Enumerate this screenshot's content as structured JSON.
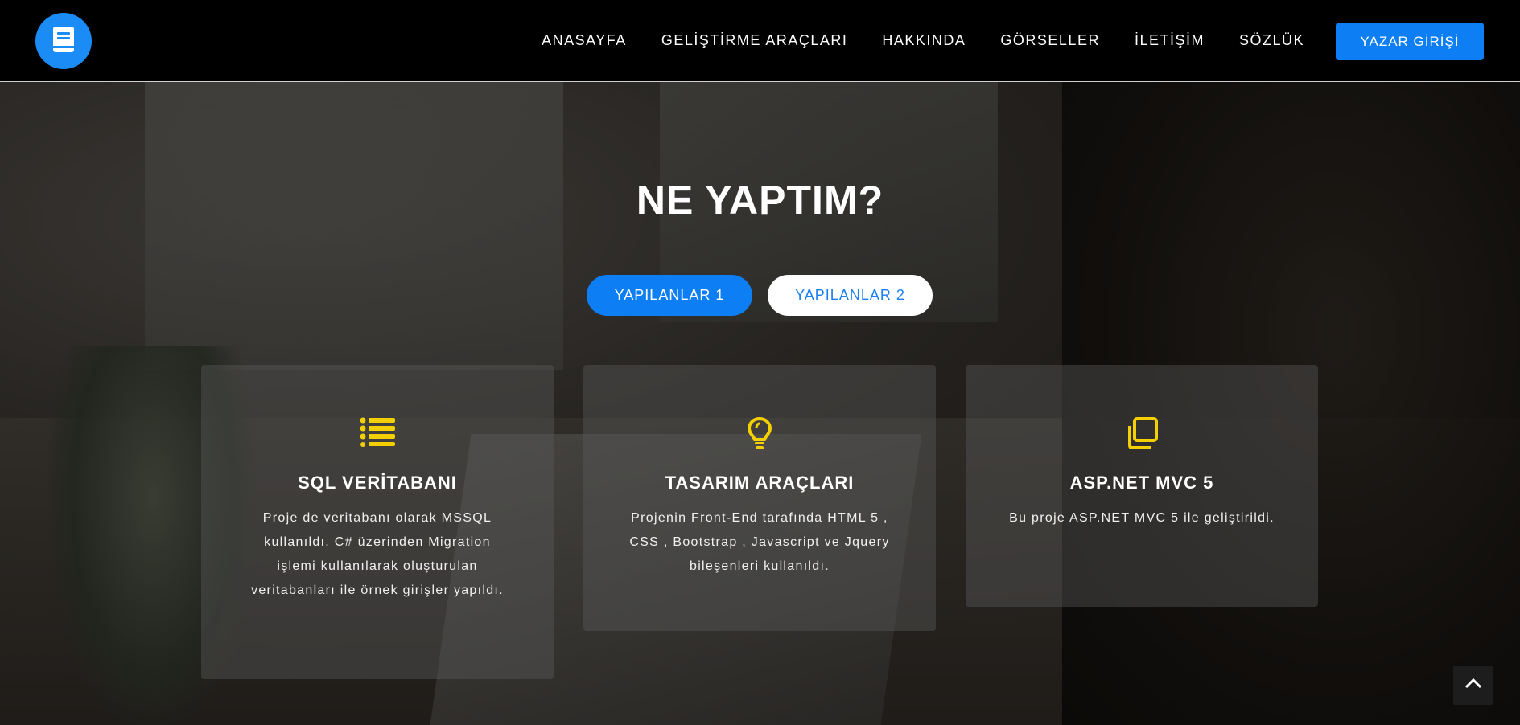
{
  "navbar": {
    "logo_icon": "book-icon",
    "links": [
      "ANASAYFA",
      "GELİŞTİRME ARAÇLARI",
      "HAKKINDA",
      "GÖRSELLER",
      "İLETİŞİM",
      "SÖZLÜK"
    ],
    "cta_label": "YAZAR GİRİŞİ"
  },
  "section": {
    "title": "NE YAPTIM?",
    "tabs": [
      {
        "label": "YAPILANLAR 1",
        "active": true
      },
      {
        "label": "YAPILANLAR 2",
        "active": false
      }
    ],
    "cards": [
      {
        "icon": "list-icon",
        "title": "SQL VERİTABANI",
        "text": "Proje de veritabanı olarak MSSQL kullanıldı. C# üzerinden Migration işlemi kullanılarak oluşturulan veritabanları ile örnek girişler yapıldı."
      },
      {
        "icon": "lightbulb-icon",
        "title": "TASARIM ARAÇLARI",
        "text": "Projenin Front-End tarafında HTML 5 , CSS , Bootstrap , Javascript ve Jquery bileşenleri kullanıldı."
      },
      {
        "icon": "copy-icon",
        "title": "ASP.NET MVC 5",
        "text": "Bu proje ASP.NET MVC 5 ile geliştirildi."
      }
    ]
  },
  "scroll_top_icon": "chevron-up-icon",
  "colors": {
    "accent": "#0d7ef3",
    "icon": "#f5d000",
    "navbar_bg": "#000000"
  }
}
